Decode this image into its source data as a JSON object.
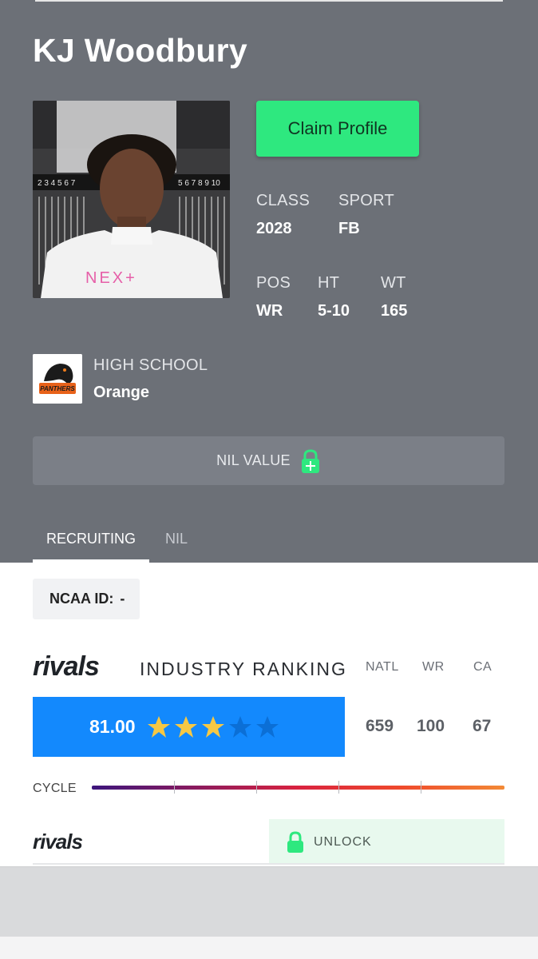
{
  "player": {
    "name": "KJ Woodbury"
  },
  "actions": {
    "claim_label": "Claim Profile"
  },
  "stats": {
    "class_label": "CLASS",
    "class_value": "2028",
    "sport_label": "SPORT",
    "sport_value": "FB",
    "pos_label": "POS",
    "pos_value": "WR",
    "ht_label": "HT",
    "ht_value": "5-10",
    "wt_label": "WT",
    "wt_value": "165"
  },
  "school": {
    "label": "HIGH SCHOOL",
    "value": "Orange",
    "logo_text": "PANTHERS"
  },
  "photo": {
    "shirt_text": "NEX+"
  },
  "nil": {
    "label": "NIL VALUE"
  },
  "tabs": [
    {
      "label": "RECRUITING",
      "active": true
    },
    {
      "label": "NIL",
      "active": false
    }
  ],
  "ncaa": {
    "label": "NCAA ID:",
    "value": "-"
  },
  "ranking": {
    "brand": "rivals",
    "title": "INDUSTRY RANKING",
    "score": "81.00",
    "stars_filled": 3,
    "stars_total": 5,
    "columns": [
      "NATL",
      "WR",
      "CA"
    ],
    "values": [
      "659",
      "100",
      "67"
    ]
  },
  "cycle": {
    "label": "CYCLE"
  },
  "rivals_row": {
    "brand": "rivals",
    "unlock_label": "UNLOCK"
  },
  "colors": {
    "accent_green": "#2ee87f",
    "score_blue": "#1389fd",
    "hero_gray": "#6c7077",
    "star_gold": "#f6c844"
  }
}
